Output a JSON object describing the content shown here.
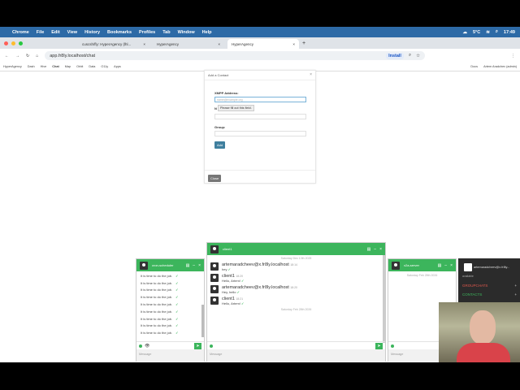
{
  "menubar": {
    "app": "Chrome",
    "items": [
      "File",
      "Edit",
      "View",
      "History",
      "Bookmarks",
      "Profiles",
      "Tab",
      "Window",
      "Help"
    ],
    "weather": "5°C",
    "clock": "17:49"
  },
  "tabs": [
    {
      "label": "cuscsh/fly: HyperAgency (lhl..."
    },
    {
      "label": "HyperAgency"
    },
    {
      "label": "HyperAgency",
      "active": true
    }
  ],
  "address": {
    "url": "app.fr8ly.localhost/chat",
    "install": "Install"
  },
  "bookmarks": {
    "items": [
      "HyperAgency",
      "Dash",
      "Hive",
      "Chat",
      "Map",
      "Orbit",
      "Data",
      "O11y",
      "Apps"
    ],
    "docs": "Docs",
    "user": "Artem Aradchev (admin)"
  },
  "dialog": {
    "title": "Add a Contact",
    "xmpp_label": "XMPP Address:",
    "xmpp_placeholder": "name@example.org",
    "tooltip": "Please fill out this field.",
    "nick_label": "N",
    "group_label": "Group:",
    "add": "Add",
    "close": "Close"
  },
  "chat_left": {
    "name": "cron-scheduler",
    "messages": [
      "It is time to do the job.",
      "It is time to do the job.",
      "It is time to do the job.",
      "It is time to do the job.",
      "It is time to do the job.",
      "It is time to do the job.",
      "It is time to do the job.",
      "It is time to do the job.",
      "It is time to do the job."
    ],
    "placeholder": "Message"
  },
  "chat_main": {
    "name": "client1",
    "date1": "Saturday Dec 13th 2025",
    "date2": "Saturday Feb 28th 2026",
    "messages": [
      {
        "from": "artemaradchеev@x.fr8ly.localhost",
        "time": "18:14",
        "text": "hey"
      },
      {
        "from": "client1",
        "time": "18:20",
        "text": "Hello, Artem!"
      },
      {
        "from": "artemaradchеev@x.fr8ly.localhost",
        "time": "18:20",
        "text": "Hey, hello"
      },
      {
        "from": "client1",
        "time": "18:21",
        "text": "Hello, Artem!"
      }
    ],
    "placeholder": "Message"
  },
  "chat_right": {
    "name": "x2a-server",
    "date": "Saturday Feb 28th 2026",
    "placeholder": "Message"
  },
  "roster": {
    "user": "artemaradchеev@x.fr8ly...",
    "status": "available",
    "groupchats": "GROUPCHATS",
    "contacts": "CONTACTS"
  },
  "colors": {
    "accent": "#3cb55c",
    "menubar": "#2d6aa6",
    "roster_bg": "#2b2b2b"
  }
}
